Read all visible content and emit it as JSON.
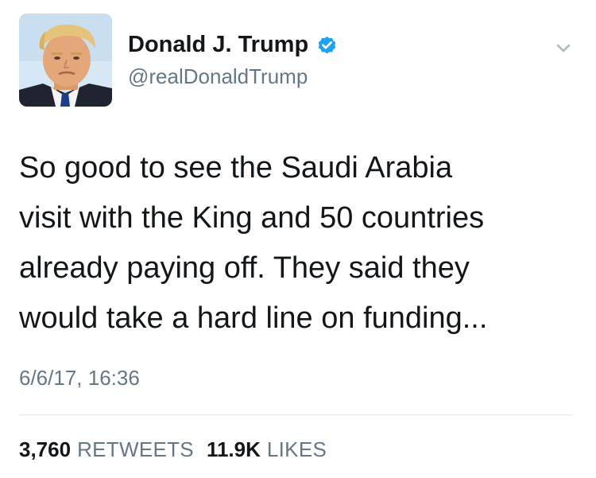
{
  "tweet": {
    "author": {
      "display_name": "Donald J. Trump",
      "handle": "@realDonaldTrump",
      "verified": true,
      "verified_icon": "verified-badge-icon",
      "verified_color": "#1da1f2"
    },
    "menu_icon": "chevron-down-icon",
    "text_lines": [
      "So good to see the Saudi Arabia",
      "visit with the King and 50 countries",
      "already paying off. They said they",
      "would take a hard line on funding..."
    ],
    "timestamp": "6/6/17, 16:36",
    "stats": {
      "retweets_count": "3,760",
      "retweets_label": "RETWEETS",
      "likes_count": "11.9K",
      "likes_label": "LIKES"
    }
  },
  "colors": {
    "text_primary": "#14171a",
    "text_secondary": "#657786",
    "divider": "#e1e8ed",
    "accent": "#1da1f2"
  }
}
